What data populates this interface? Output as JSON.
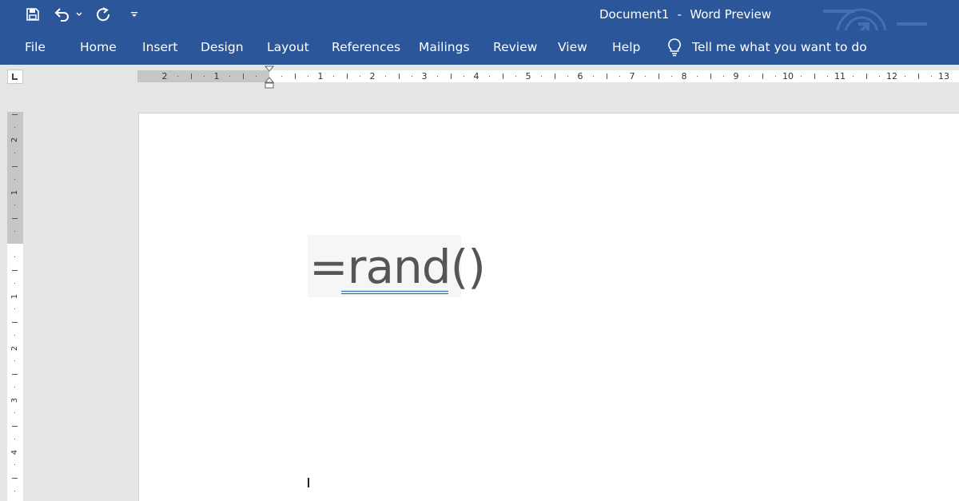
{
  "titlebar": {
    "document_name": "Document1",
    "separator": "-",
    "app_name": "Word Preview",
    "background_color": "#2b579a",
    "qat": {
      "save_icon": "save-icon",
      "undo_icon": "undo-icon",
      "undo_dropdown_icon": "chevron-down-icon",
      "redo_icon": "redo-icon",
      "customize_icon": "customize-qat-icon"
    }
  },
  "ribbon": {
    "tabs": [
      {
        "label": "File"
      },
      {
        "label": "Home"
      },
      {
        "label": "Insert"
      },
      {
        "label": "Design"
      },
      {
        "label": "Layout"
      },
      {
        "label": "References"
      },
      {
        "label": "Mailings"
      },
      {
        "label": "Review"
      },
      {
        "label": "View"
      },
      {
        "label": "Help"
      }
    ],
    "tell_me": {
      "icon": "lightbulb-icon",
      "text": "Tell me what you want to do"
    }
  },
  "horizontal_ruler": {
    "labels": [
      "2",
      "1",
      "1",
      "2",
      "3",
      "4",
      "5",
      "6",
      "7",
      "8",
      "9",
      "10",
      "11",
      "12",
      "13"
    ]
  },
  "vertical_ruler": {
    "labels": [
      "2",
      "1",
      "1",
      "2",
      "3",
      "4"
    ]
  },
  "document": {
    "formula_equals": "=",
    "formula_text": "rand()",
    "proofing_color": "#2e75b6"
  }
}
